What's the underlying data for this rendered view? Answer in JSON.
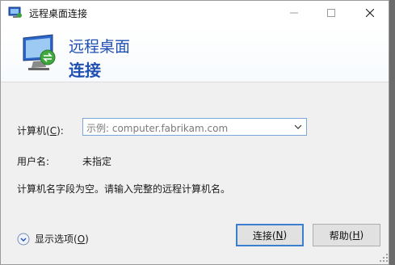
{
  "window": {
    "title": "远程桌面连接",
    "icon": "remote-desktop-icon"
  },
  "banner": {
    "line1": "远程桌面",
    "line2": "连接"
  },
  "form": {
    "computer_label_pre": "计算机(",
    "computer_label_key": "C",
    "computer_label_post": "):",
    "computer_placeholder": "示例: computer.fabrikam.com",
    "username_label": "用户名:",
    "username_value": "未指定",
    "message": "计算机名字段为空。请输入完整的远程计算机名。"
  },
  "footer": {
    "options_pre": "显示选项(",
    "options_key": "O",
    "options_post": ")",
    "connect_pre": "连接(",
    "connect_key": "N",
    "connect_post": ")",
    "help_pre": "帮助(",
    "help_key": "H",
    "help_post": ")"
  },
  "colors": {
    "accent": "#1f4fb3",
    "focus_border": "#3c7fd0"
  }
}
